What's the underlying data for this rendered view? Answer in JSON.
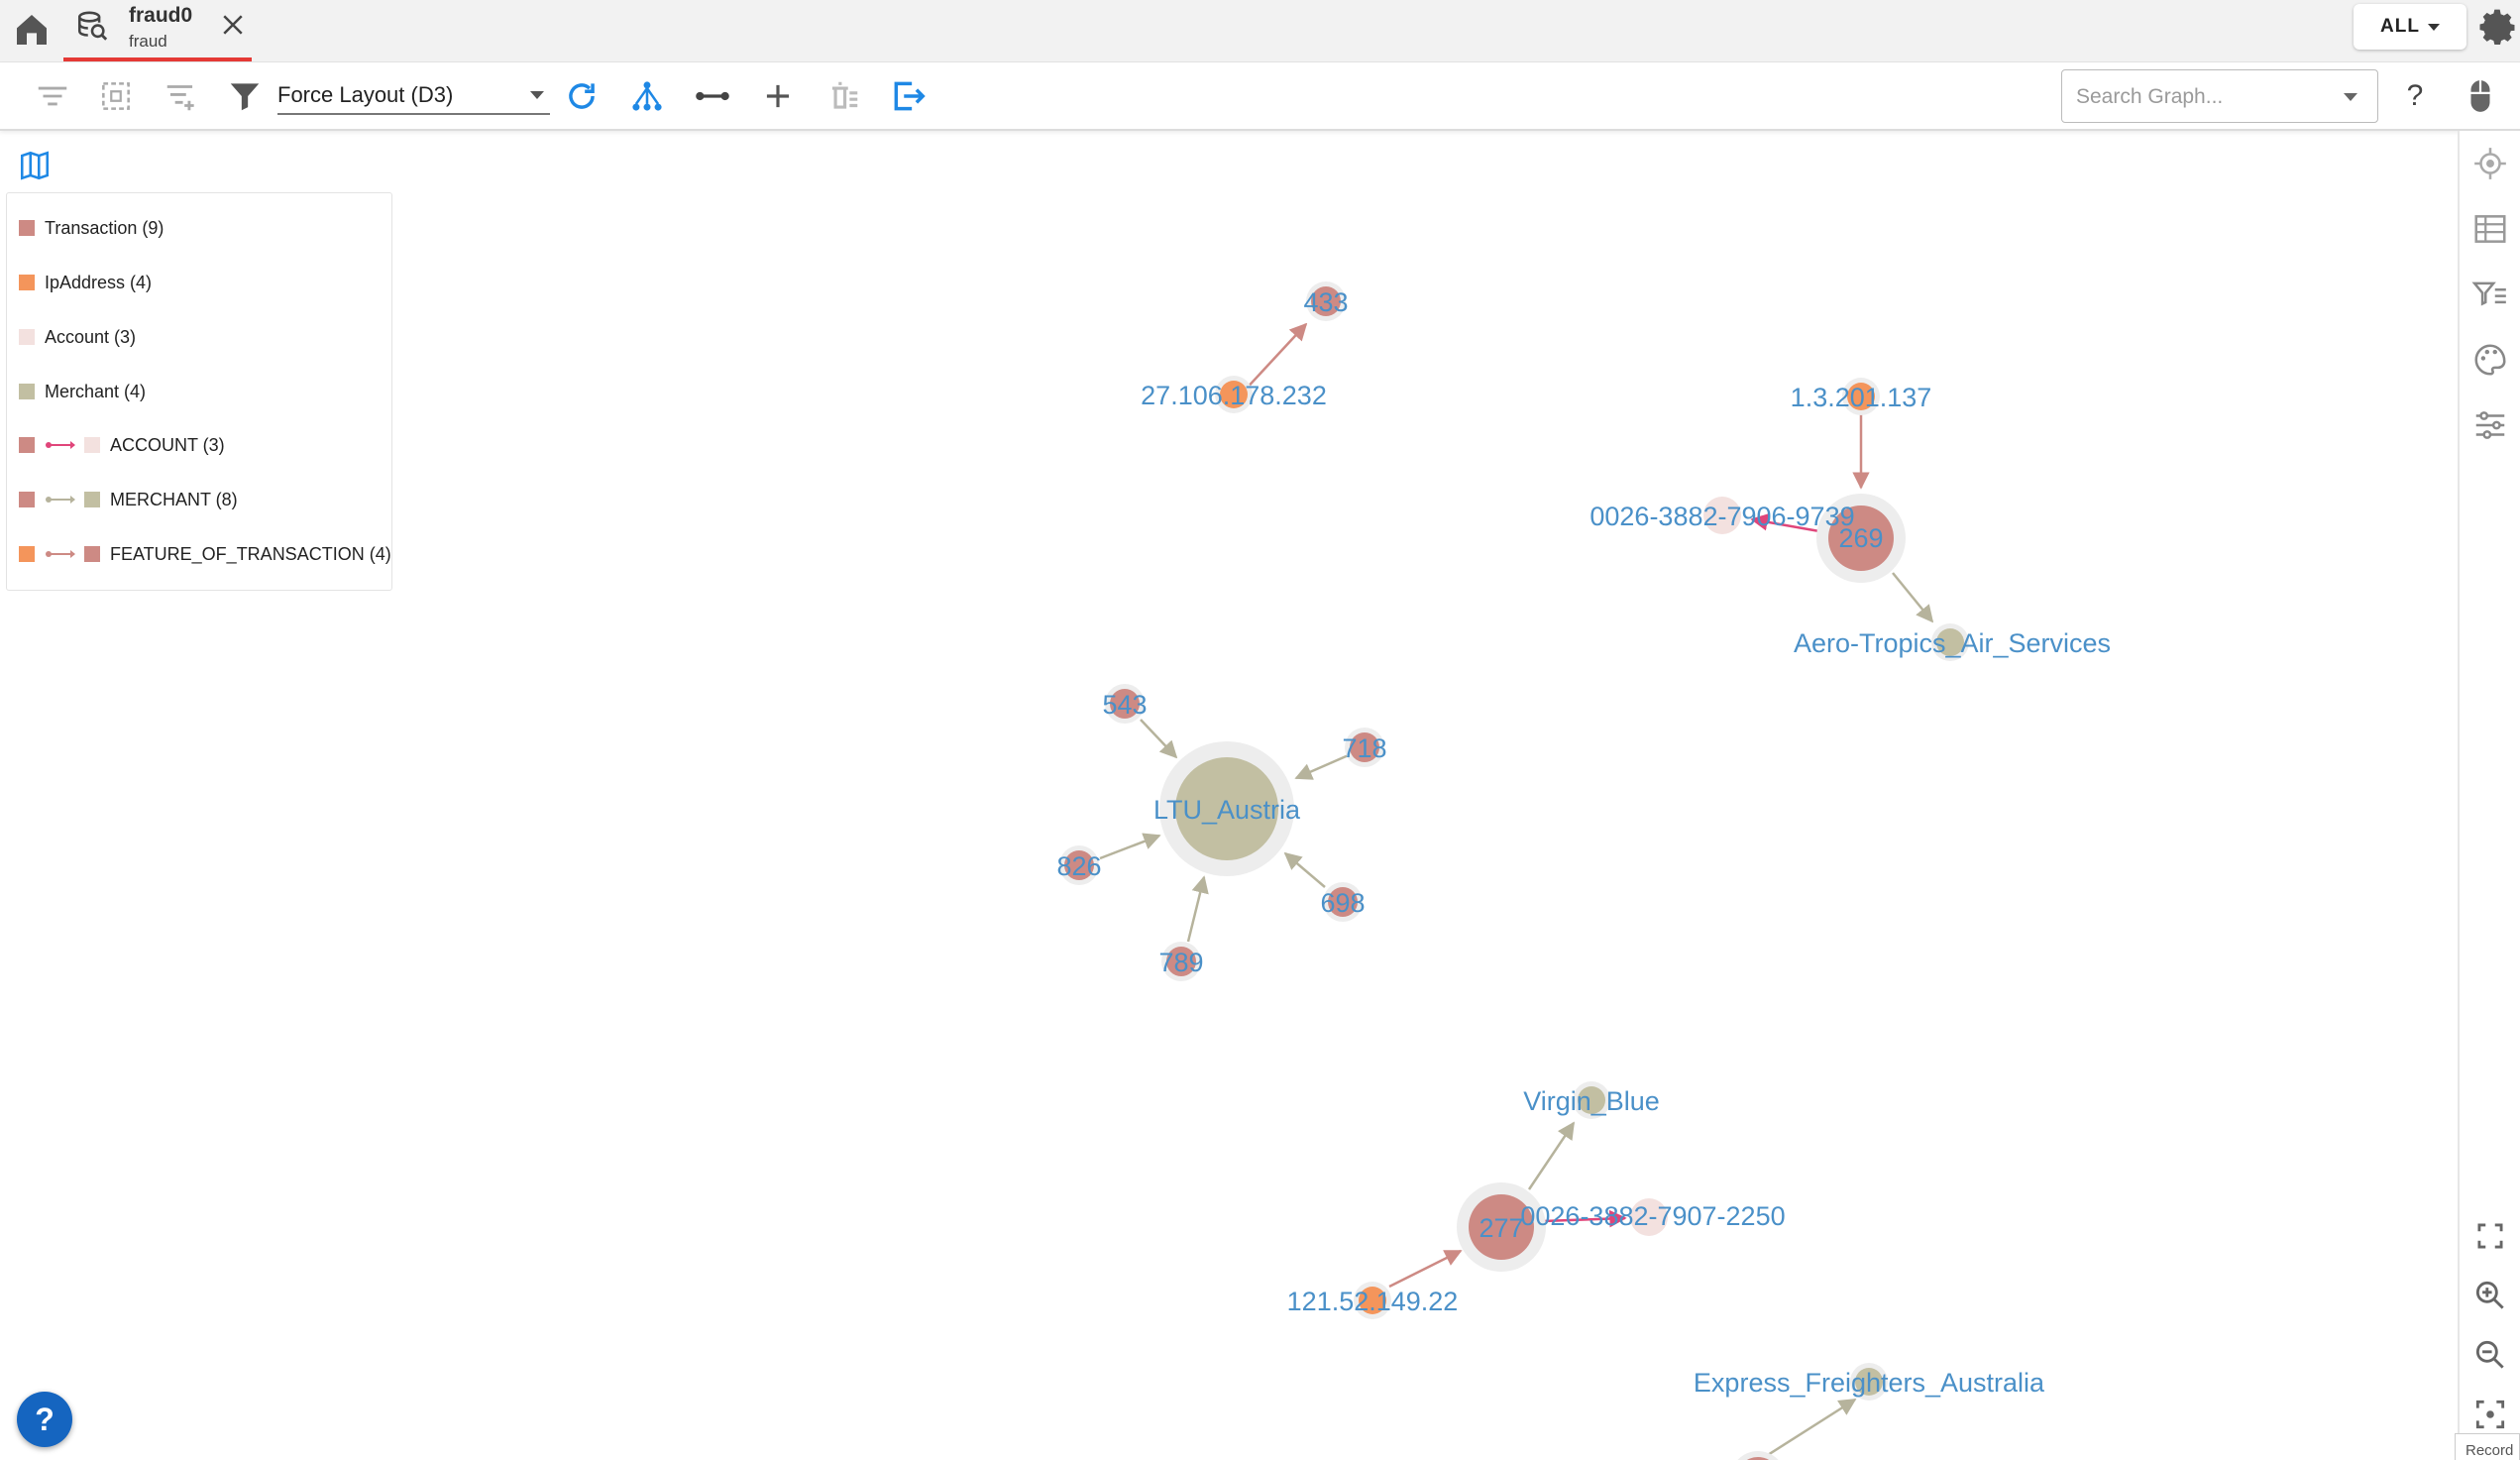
{
  "tabbar": {
    "db_name": "fraud0",
    "db_subtitle": "fraud",
    "scope_label": "ALL"
  },
  "toolbar": {
    "layout_value": "Force Layout (D3)",
    "search_placeholder": "Search Graph...",
    "help_label": "?"
  },
  "legend": {
    "items": [
      {
        "label": "Transaction (9)",
        "color": "#cd8a84",
        "kind": "node"
      },
      {
        "label": "IpAddress (4)",
        "color": "#f4955b",
        "kind": "node"
      },
      {
        "label": "Account (3)",
        "color": "#f3e1df",
        "kind": "node"
      },
      {
        "label": "Merchant (4)",
        "color": "#c2bfa2",
        "kind": "node"
      },
      {
        "label": "ACCOUNT (3)",
        "color": "#e0457a",
        "from": "#cd8a84",
        "to": "#f3e1df",
        "kind": "edge"
      },
      {
        "label": "MERCHANT (8)",
        "color": "#b6b39c",
        "from": "#cd8a84",
        "to": "#c2bfa2",
        "kind": "edge"
      },
      {
        "label": "FEATURE_OF_TRANSACTION (4)",
        "color": "#cd8a84",
        "from": "#f4955b",
        "to": "#cd8a84",
        "kind": "edge"
      }
    ]
  },
  "graph": {
    "nodes": [
      {
        "id": "n433",
        "label": "433",
        "type": "transaction"
      },
      {
        "id": "n27",
        "label": "27.106.178.232",
        "type": "ip"
      },
      {
        "id": "n13",
        "label": "1.3.201.137",
        "type": "ip"
      },
      {
        "id": "n269",
        "label": "269",
        "type": "transaction"
      },
      {
        "id": "nacc1",
        "label": "0026-3882-7906-9739",
        "type": "account"
      },
      {
        "id": "naero",
        "label": "Aero-Tropics_Air_Services",
        "type": "merchant"
      },
      {
        "id": "n543",
        "label": "543",
        "type": "transaction"
      },
      {
        "id": "n718",
        "label": "718",
        "type": "transaction"
      },
      {
        "id": "nltu",
        "label": "LTU_Austria",
        "type": "merchant"
      },
      {
        "id": "n826",
        "label": "826",
        "type": "transaction"
      },
      {
        "id": "n698",
        "label": "698",
        "type": "transaction"
      },
      {
        "id": "n789",
        "label": "789",
        "type": "transaction"
      },
      {
        "id": "nvir",
        "label": "Virgin_Blue",
        "type": "merchant"
      },
      {
        "id": "n277",
        "label": "277",
        "type": "transaction"
      },
      {
        "id": "nacc2",
        "label": "0026-3882-7907-2250",
        "type": "account"
      },
      {
        "id": "n121",
        "label": "121.52.149.22",
        "type": "ip"
      },
      {
        "id": "nexp",
        "label": "Express_Freighters_Australia",
        "type": "merchant"
      },
      {
        "id": "ncut",
        "label": "",
        "type": "transaction"
      }
    ]
  },
  "record_tab": "Record"
}
